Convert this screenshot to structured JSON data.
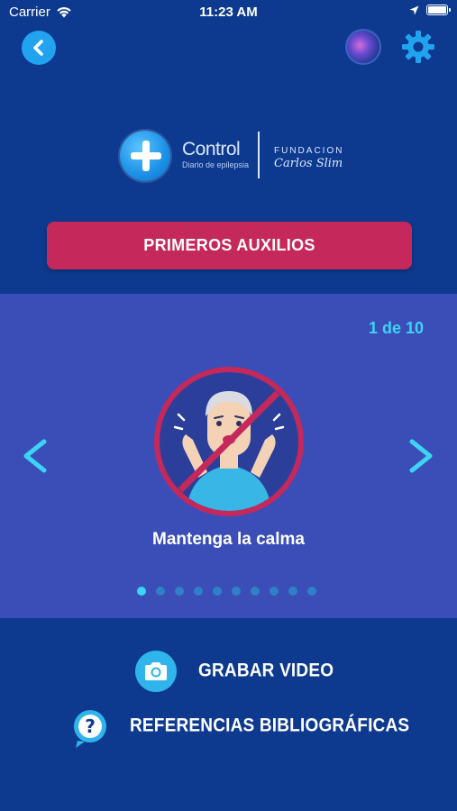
{
  "status_bar": {
    "carrier": "Carrier",
    "time": "11:23 AM"
  },
  "header": {
    "back_icon": "chevron-left-icon",
    "avatar": "brain-avatar",
    "settings_icon": "gear-icon"
  },
  "logo": {
    "title": "Control",
    "subtitle": "Diario de epilepsia",
    "foundation": "FUNDACION",
    "foundation_name": "Carlos Slim"
  },
  "primary_button": {
    "label": "PRIMEROS AUXILIOS",
    "color": "#c5285a"
  },
  "carousel": {
    "counter": "1 de 10",
    "caption": "Mantenga la calma",
    "current_index": 1,
    "total": 10,
    "accent": "#3dd3f2"
  },
  "actions": {
    "record_video": "GRABAR VIDEO",
    "references": "REFERENCIAS BIBLIOGRÁFICAS"
  },
  "colors": {
    "background": "#0d3a8e",
    "panel": "#3b4eb7",
    "button_blue": "#22a3f0"
  }
}
